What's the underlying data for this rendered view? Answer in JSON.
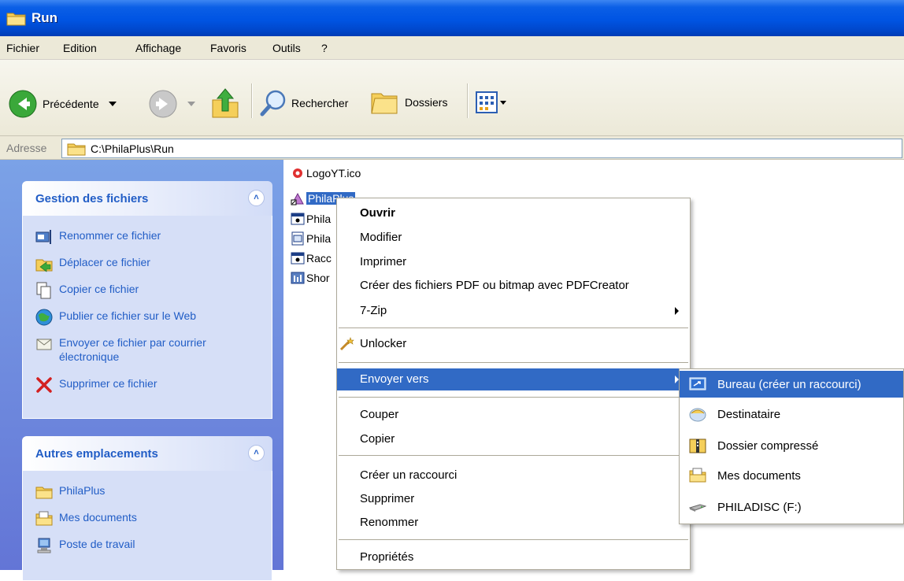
{
  "window": {
    "title": "Run"
  },
  "menu": {
    "items": [
      "Fichier",
      "Edition",
      "Affichage",
      "Favoris",
      "Outils",
      "?"
    ]
  },
  "toolbar": {
    "back_label": "Précédente",
    "search_label": "Rechercher",
    "folders_label": "Dossiers"
  },
  "address": {
    "label": "Adresse",
    "path": "C:\\PhilaPlus\\Run"
  },
  "tasks_panel": {
    "title": "Gestion des fichiers",
    "items": [
      "Renommer ce fichier",
      "Déplacer ce fichier",
      "Copier ce fichier",
      "Publier ce fichier sur le Web",
      "Envoyer ce fichier par courrier électronique",
      "Supprimer ce fichier"
    ]
  },
  "places_panel": {
    "title": "Autres emplacements",
    "items": [
      "PhilaPlus",
      "Mes documents",
      "Poste de travail"
    ]
  },
  "files": {
    "items": [
      "LogoYT.ico",
      "PhilaPlus",
      "Phila",
      "Phila",
      "Racc",
      "Shor"
    ],
    "selected_index": 1
  },
  "context_menu": {
    "open": "Ouvrir",
    "edit": "Modifier",
    "print": "Imprimer",
    "pdfcreator": "Créer des fichiers PDF ou bitmap avec PDFCreator",
    "zip": "7-Zip",
    "unlocker": "Unlocker",
    "send_to": "Envoyer vers",
    "cut": "Couper",
    "copy": "Copier",
    "create_shortcut": "Créer un raccourci",
    "delete": "Supprimer",
    "rename": "Renommer",
    "properties": "Propriétés"
  },
  "send_to_menu": {
    "items": [
      "Bureau (créer un raccourci)",
      "Destinataire",
      "Dossier compressé",
      "Mes documents",
      "PHILADISC (F:)"
    ]
  },
  "colors": {
    "titlebar": "#0054e3",
    "selection": "#316ac5",
    "task_link": "#215dc6",
    "left_pane": "#7ba2e7"
  }
}
